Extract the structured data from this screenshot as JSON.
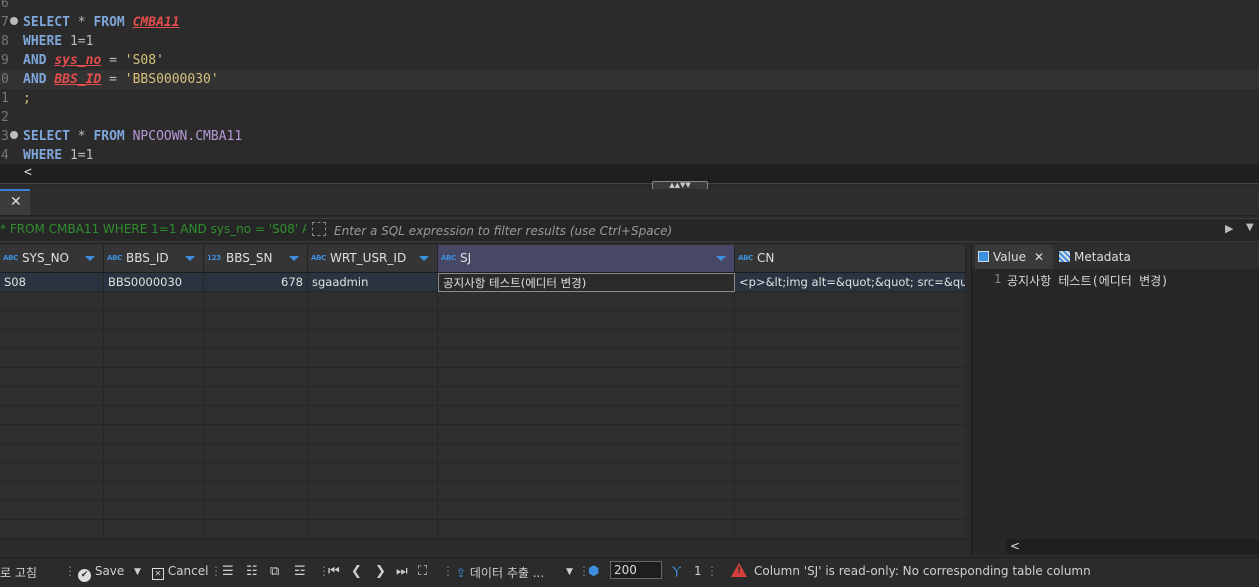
{
  "editor": {
    "lines": [
      {
        "ln": "6",
        "tokens": []
      },
      {
        "ln": "7",
        "fold": true,
        "tokens": [
          [
            "kw",
            "SELECT"
          ],
          [
            "plain",
            " * "
          ],
          [
            "kw",
            "FROM"
          ],
          [
            "plain",
            " "
          ],
          [
            "err",
            "CMBA11"
          ]
        ]
      },
      {
        "ln": "8",
        "tokens": [
          [
            "kw",
            "WHERE"
          ],
          [
            "plain",
            " 1=1"
          ]
        ]
      },
      {
        "ln": "9",
        "tokens": [
          [
            "kw",
            "AND"
          ],
          [
            "plain",
            " "
          ],
          [
            "err",
            "sys_no"
          ],
          [
            "plain",
            " = "
          ],
          [
            "str",
            "'S08'"
          ]
        ]
      },
      {
        "ln": "0",
        "current": true,
        "tokens": [
          [
            "kw",
            "AND"
          ],
          [
            "plain",
            " "
          ],
          [
            "err",
            "BBS_ID"
          ],
          [
            "plain",
            " = "
          ],
          [
            "str",
            "'BBS0000030'"
          ]
        ]
      },
      {
        "ln": "1",
        "tokens": [
          [
            "str",
            ";"
          ]
        ]
      },
      {
        "ln": "2",
        "tokens": []
      },
      {
        "ln": "3",
        "fold": true,
        "tokens": [
          [
            "kw",
            "SELECT"
          ],
          [
            "plain",
            " * "
          ],
          [
            "kw",
            "FROM"
          ],
          [
            "plain",
            " "
          ],
          [
            "obj",
            "NPCOOWN.CMBA11"
          ]
        ]
      },
      {
        "ln": "4",
        "tokens": [
          [
            "kw",
            "WHERE"
          ],
          [
            "plain",
            " 1=1"
          ]
        ]
      }
    ],
    "hscroll_left": "<"
  },
  "splitter": {
    "handle": "▲▲▼▼"
  },
  "results_tab": {
    "close": "✕"
  },
  "filter": {
    "history": "* FROM CMBA11 WHERE 1=1 AND sys_no = 'S08' AND",
    "placeholder": "Enter a SQL expression to filter results (use Ctrl+Space)",
    "run": "▶",
    "dropdown": "▼"
  },
  "grid": {
    "columns": [
      {
        "type": "ABC",
        "name": "SYS_NO"
      },
      {
        "type": "ABC",
        "name": "BBS_ID"
      },
      {
        "type": "123",
        "name": "BBS_SN"
      },
      {
        "type": "ABC",
        "name": "WRT_USR_ID"
      },
      {
        "type": "ABC",
        "name": "SJ",
        "selected": true
      },
      {
        "type": "ABC",
        "name": "CN"
      }
    ],
    "rows": [
      [
        "S08",
        "BBS0000030",
        "678",
        "sgaadmin",
        "공지사항 테스트(에디터 변경)",
        "<p>&lt;img alt=&quot;&quot; src=&quot;"
      ]
    ],
    "empty_rows": 14,
    "hscroll_right": ">"
  },
  "value_panel": {
    "tabs": [
      {
        "label": "Value",
        "icon": "value-icon",
        "close": "✕"
      },
      {
        "label": "Metadata",
        "icon": "metadata-icon"
      }
    ],
    "line_number": "1",
    "text": "공지사항 테스트(에디터 변경)",
    "hscroll_left": "<"
  },
  "toolbar": {
    "refresh_label": "로 고침",
    "save_label": "Save",
    "cancel_label": "Cancel",
    "export_label": "데이터 추출 ...",
    "fetch_size": "200",
    "row_count": "1",
    "status": "Column 'SJ' is read-only: No corresponding table column"
  },
  "colors": {
    "background": "#2b2b2b",
    "keyword": "#7ea6d9",
    "string": "#d7c27a",
    "error": "#e24d4d",
    "accent": "#3e8fe0",
    "selected_header": "#474766",
    "warning": "#d84040"
  }
}
